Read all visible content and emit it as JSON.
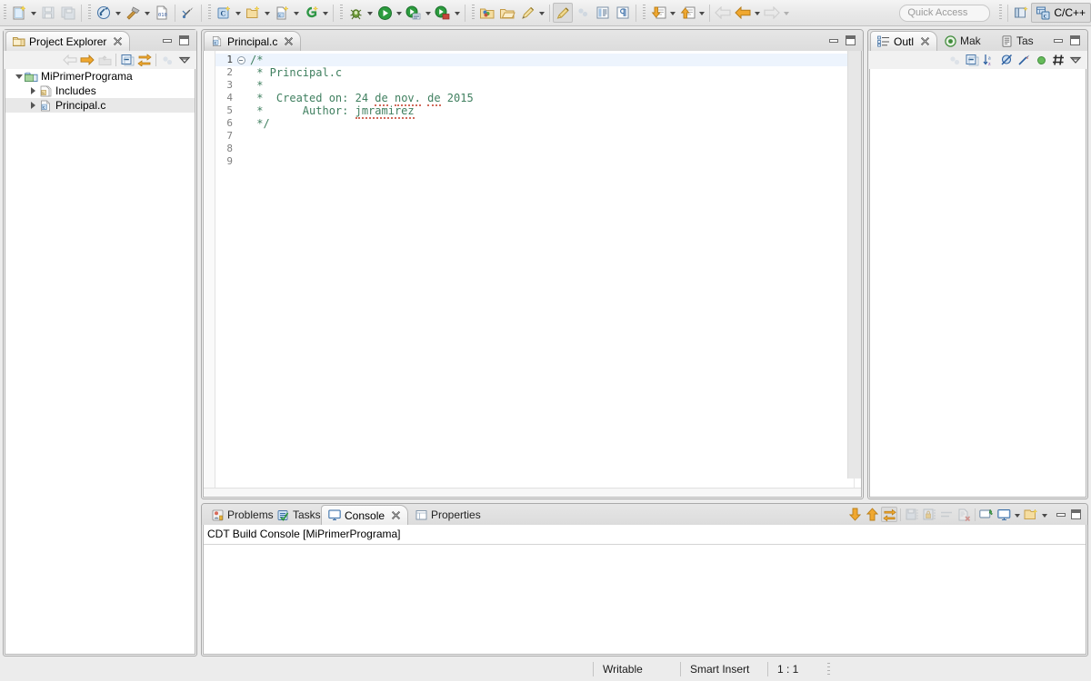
{
  "toolbar": {
    "quick_access_placeholder": "Quick Access",
    "perspective_label": "C/C++",
    "buttons": [
      {
        "name": "new-c-project",
        "icon": "new-file-icon"
      },
      {
        "name": "save",
        "icon": "save-icon"
      },
      {
        "name": "save-all",
        "icon": "save-all-icon"
      },
      {
        "name": "build-all",
        "icon": "build-all-icon"
      },
      {
        "name": "build",
        "icon": "hammer-icon"
      },
      {
        "name": "binaries",
        "icon": "binary-file-icon"
      },
      {
        "name": "clean",
        "icon": "clean-icon"
      },
      {
        "name": "new-c-class",
        "icon": "new-class-icon"
      },
      {
        "name": "new-folder",
        "icon": "new-folder-icon"
      },
      {
        "name": "new-source-file",
        "icon": "new-source-icon"
      },
      {
        "name": "new-wizard",
        "icon": "new-wizard-icon"
      },
      {
        "name": "debug",
        "icon": "bug-icon"
      },
      {
        "name": "run",
        "icon": "run-icon"
      },
      {
        "name": "run-config",
        "icon": "run-config-icon"
      },
      {
        "name": "external-tools",
        "icon": "external-tools-icon"
      },
      {
        "name": "open-resource",
        "icon": "open-resource-icon"
      },
      {
        "name": "open-type",
        "icon": "open-type-icon"
      },
      {
        "name": "search",
        "icon": "search-pencil-icon"
      },
      {
        "name": "annotation",
        "icon": "marker-icon"
      },
      {
        "name": "next-annotation",
        "icon": "dots-icon"
      },
      {
        "name": "toggle-block-selection",
        "icon": "block-selection-icon"
      },
      {
        "name": "show-whitespace",
        "icon": "pilcrow-icon"
      },
      {
        "name": "next-edit",
        "icon": "down-arrow-doc-icon"
      },
      {
        "name": "prev-edit",
        "icon": "up-arrow-doc-icon"
      },
      {
        "name": "back-disabled",
        "icon": "back-arrow-icon"
      },
      {
        "name": "back",
        "icon": "back-arrow-icon"
      },
      {
        "name": "forward",
        "icon": "forward-arrow-icon"
      }
    ]
  },
  "project_explorer": {
    "tab_label": "Project Explorer",
    "tree": [
      {
        "label": "MiPrimerPrograma",
        "icon": "project-icon",
        "state": "expanded",
        "indent": 0,
        "selected": false
      },
      {
        "label": "Includes",
        "icon": "includes-icon",
        "state": "collapsed",
        "indent": 1,
        "selected": false
      },
      {
        "label": "Principal.c",
        "icon": "c-file-icon",
        "state": "collapsed",
        "indent": 1,
        "selected": true
      }
    ],
    "toolbar": [
      {
        "name": "back-button",
        "icon": "back-arrow-icon",
        "enabled": false
      },
      {
        "name": "forward-button",
        "icon": "forward-arrow-icon",
        "enabled": true
      },
      {
        "name": "up-button",
        "icon": "up-level-icon",
        "enabled": false
      },
      {
        "name": "collapse-all-button",
        "icon": "collapse-all-icon",
        "enabled": true
      },
      {
        "name": "link-with-editor-button",
        "icon": "link-editor-icon",
        "enabled": true
      },
      {
        "name": "focus-on-active-task-button",
        "icon": "focus-task-icon",
        "enabled": false
      },
      {
        "name": "view-menu-button",
        "icon": "view-menu-icon",
        "enabled": true
      }
    ]
  },
  "editor": {
    "tab_label": "Principal.c",
    "tab_icon": "c-file-icon",
    "lines": [
      {
        "num": "1",
        "text": "/*",
        "fold": true,
        "highlight": true
      },
      {
        "num": "2",
        "text": " * Principal.c",
        "fold": false,
        "highlight": false
      },
      {
        "num": "3",
        "text": " *",
        "fold": false,
        "highlight": false
      },
      {
        "num": "4",
        "text": " *  Created on: 24 de nov. de 2015",
        "fold": false,
        "highlight": false
      },
      {
        "num": "5",
        "text": " *      Author: jmramirez",
        "fold": false,
        "highlight": false
      },
      {
        "num": "6",
        "text": " */",
        "fold": false,
        "highlight": false
      },
      {
        "num": "7",
        "text": "",
        "fold": false,
        "highlight": false
      },
      {
        "num": "8",
        "text": "",
        "fold": false,
        "highlight": false
      },
      {
        "num": "9",
        "text": "",
        "fold": false,
        "highlight": false
      }
    ],
    "comment_color": "#3f7f5f",
    "spelling_words": [
      "de",
      "nov.",
      "de",
      "jmramirez"
    ]
  },
  "outline": {
    "tabs": [
      {
        "label": "Outl",
        "icon": "outline-icon",
        "active": true
      },
      {
        "label": "Mak",
        "icon": "make-target-icon",
        "active": false
      },
      {
        "label": "Tas",
        "icon": "task-list-icon",
        "active": false
      }
    ],
    "toolbar": [
      {
        "name": "focus-on-active-task-button",
        "icon": "focus-task-icon",
        "enabled": false
      },
      {
        "name": "collapse-all-button",
        "icon": "collapse-all-icon",
        "enabled": true
      },
      {
        "name": "sort-button",
        "icon": "sort-az-icon",
        "enabled": true
      },
      {
        "name": "hide-fields-button",
        "icon": "hide-fields-icon",
        "enabled": true
      },
      {
        "name": "hide-static-button",
        "icon": "hide-static-icon",
        "enabled": true
      },
      {
        "name": "hide-non-public-button",
        "icon": "hide-non-public-icon",
        "enabled": true
      },
      {
        "name": "hide-macros-button",
        "icon": "hide-macros-icon",
        "enabled": true
      },
      {
        "name": "view-menu-button",
        "icon": "view-menu-icon",
        "enabled": true
      }
    ]
  },
  "console": {
    "tabs": [
      {
        "label": "Problems",
        "icon": "problems-icon",
        "active": false
      },
      {
        "label": "Tasks",
        "icon": "tasks-icon",
        "active": false
      },
      {
        "label": "Console",
        "icon": "console-icon",
        "active": true
      },
      {
        "label": "Properties",
        "icon": "properties-icon",
        "active": false
      }
    ],
    "title": "CDT Build Console [MiPrimerPrograma]",
    "body_text": "",
    "toolbar": [
      {
        "name": "scroll-down-button",
        "icon": "down-arrow-icon",
        "enabled": true
      },
      {
        "name": "scroll-up-button",
        "icon": "up-arrow-icon",
        "enabled": true
      },
      {
        "name": "scroll-lock-button",
        "icon": "scroll-lock-icon",
        "enabled": true,
        "pressed": true
      },
      {
        "name": "save-console-button",
        "icon": "save-console-icon",
        "enabled": false
      },
      {
        "name": "lock-console-button",
        "icon": "lock-console-icon",
        "enabled": false
      },
      {
        "name": "clear-console-button",
        "icon": "clear-lines-icon",
        "enabled": false
      },
      {
        "name": "remove-console-button",
        "icon": "remove-console-icon",
        "enabled": false
      },
      {
        "name": "new-console-view-button",
        "icon": "new-console-icon",
        "enabled": true
      },
      {
        "name": "display-console-button",
        "icon": "display-console-icon",
        "enabled": true
      },
      {
        "name": "open-console-button",
        "icon": "open-console-icon",
        "enabled": true
      }
    ]
  },
  "statusbar": {
    "writable": "Writable",
    "insert_mode": "Smart Insert",
    "position": "1 : 1"
  },
  "colors": {
    "accent_orange": "#f0a830",
    "comment_green": "#3f7f5f",
    "panel_bg": "#f1f1f1",
    "chrome_bg": "#ececec",
    "selection_gray": "#e8e8e8",
    "line_highlight": "#edf4fd",
    "spell_error": "#d06a5a"
  }
}
